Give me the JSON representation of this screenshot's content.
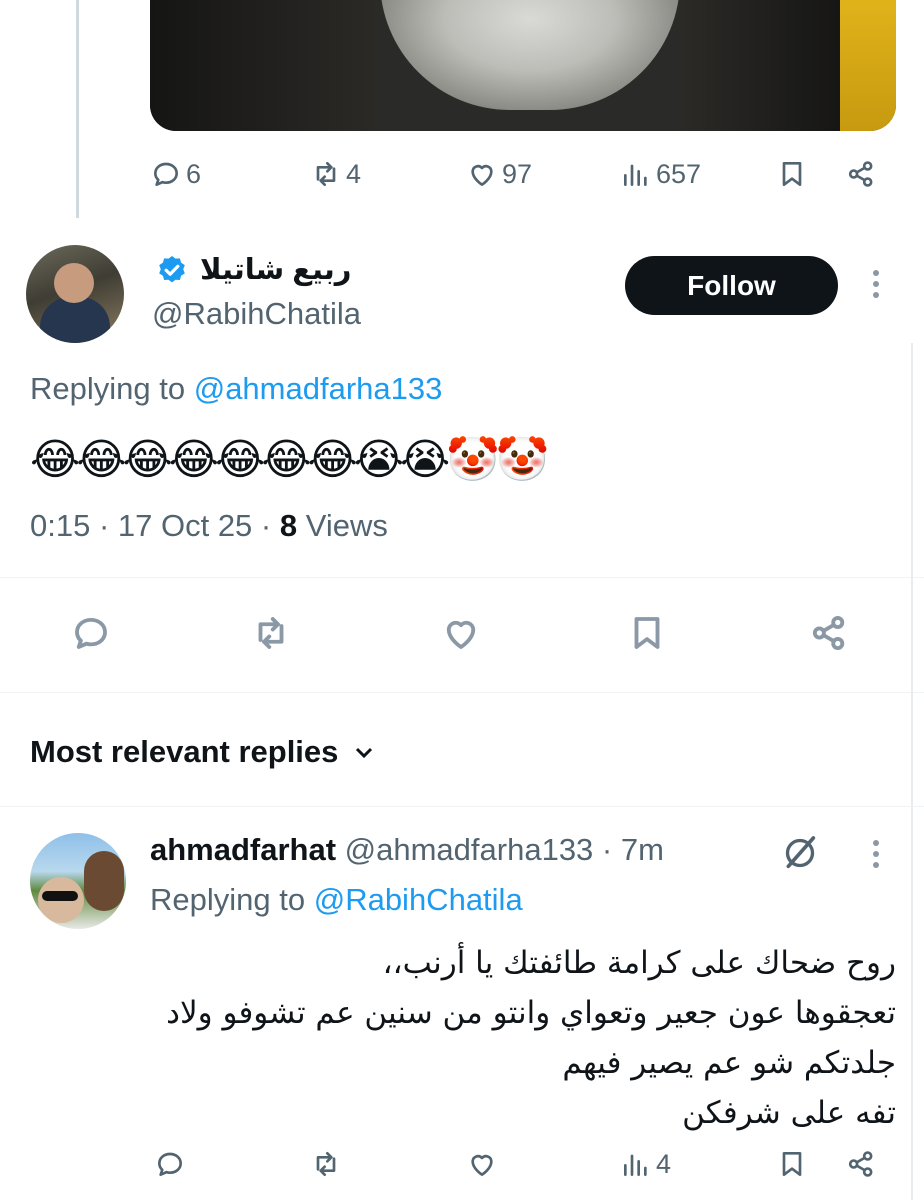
{
  "top_tweet": {
    "stats": {
      "replies": "6",
      "reposts": "4",
      "likes": "97",
      "views": "657"
    }
  },
  "main_tweet": {
    "display_name": "ربيع شاتيلا",
    "handle": "@RabihChatila",
    "follow_label": "Follow",
    "replying_prefix": "Replying to ",
    "replying_to": "@ahmadfarha133",
    "text": "😂😂😂😂😂😂😂😭😭🤡🤡",
    "time": "0:15 · 17 Oct 25 · ",
    "views_count": "8",
    "views_label": " Views"
  },
  "sort": {
    "label": "Most relevant replies"
  },
  "reply": {
    "name": "ahmadfarhat",
    "handle_time": " @ahmadfarha133 · 7m",
    "replying_prefix": "Replying to ",
    "replying_to": "@RabihChatila",
    "lines": [
      "روح ضحاك على كرامة طائفتك يا أرنب،،",
      "تعجقوها عون جعير وتعواي وانتو من سنين عم تشوفو ولاد",
      "جلدتكم شو عم يصير فيهم",
      "تفه على شرفكن"
    ],
    "stats": {
      "views": "4"
    }
  },
  "colors": {
    "accent": "#1d9bf0",
    "text": "#0f1419",
    "muted": "#536471",
    "button": "#0f1419"
  },
  "icons": [
    "reply-icon",
    "repost-icon",
    "like-icon",
    "views-icon",
    "bookmark-icon",
    "share-icon",
    "verified-badge-icon",
    "more-icon",
    "chevron-down-icon",
    "grok-icon"
  ]
}
